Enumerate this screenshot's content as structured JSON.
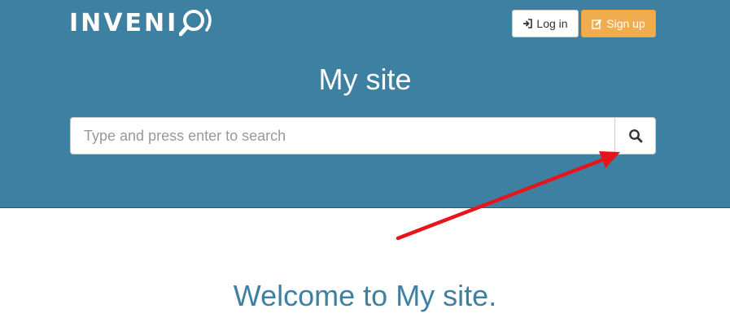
{
  "header": {
    "logo_text": "INVENI",
    "login_label": "Log in",
    "signup_label": "Sign up",
    "site_title": "My site",
    "background_color": "#3e80a2"
  },
  "search": {
    "placeholder": "Type and press enter to search",
    "button_icon": "search-icon"
  },
  "main": {
    "welcome_text": "Welcome to My site."
  },
  "annotation": {
    "arrow_color": "#e8141b",
    "arrow_icon": "red-arrow"
  }
}
